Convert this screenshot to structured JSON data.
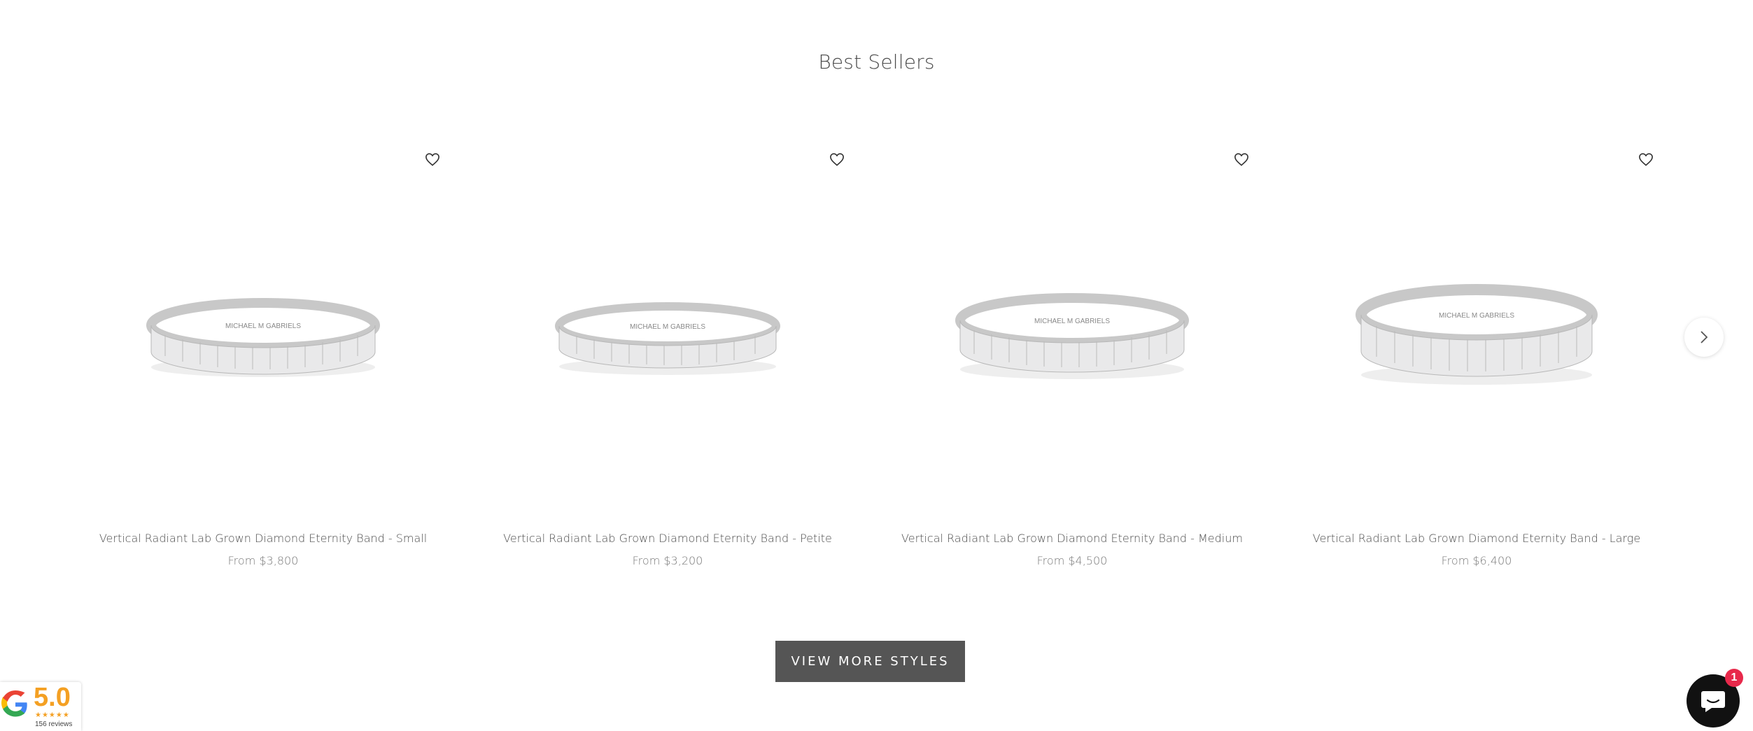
{
  "section": {
    "title": "Best Sellers"
  },
  "products": [
    {
      "title": "Vertical Radiant Lab Grown Diamond Eternity Band - Small",
      "price": "From $3,800",
      "image_alt": "MICHAEL M GABRIELS"
    },
    {
      "title": "Vertical Radiant Lab Grown Diamond Eternity Band - Petite",
      "price": "From $3,200",
      "image_alt": "MICHAEL M GABRIELS"
    },
    {
      "title": "Vertical Radiant Lab Grown Diamond Eternity Band - Medium",
      "price": "From $4,500",
      "image_alt": "MICHAEL M GABRIELS"
    },
    {
      "title": "Vertical Radiant Lab Grown Diamond Eternity Band - Large",
      "price": "From $6,400",
      "image_alt": "MICHAEL M GABRIELS"
    }
  ],
  "icons": {
    "wishlist": "heart-outline-icon",
    "next": "chevron-right-icon",
    "chat": "chat-bubble-icon",
    "google": "google-g-icon"
  },
  "view_more": {
    "label": "VIEW MORE STYLES"
  },
  "google_badge": {
    "score": "5.0",
    "stars": "★★★★★",
    "reviews": "156 reviews"
  },
  "chat": {
    "badge_count": "1"
  },
  "colors": {
    "button_bg": "#555555",
    "badge_red": "#e8294b",
    "google_orange": "#f4a023",
    "chat_bg": "#111111"
  }
}
